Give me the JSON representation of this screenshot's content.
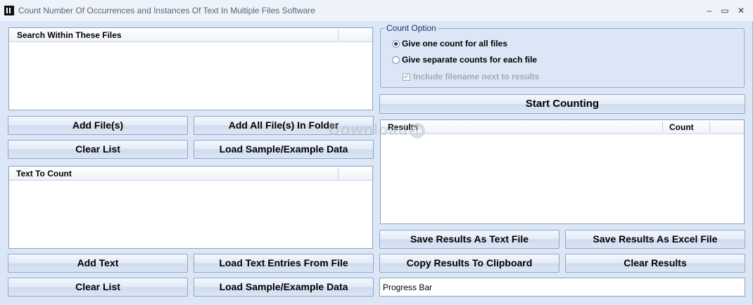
{
  "window": {
    "title": "Count Number Of Occurrences and Instances Of Text In Multiple Files Software",
    "minimize": "–",
    "maximize": "▭",
    "close": "✕"
  },
  "files_panel": {
    "header": "Search Within These Files",
    "add_files": "Add File(s)",
    "add_folder": "Add All File(s) In Folder",
    "clear_list": "Clear List",
    "load_sample": "Load Sample/Example Data"
  },
  "text_panel": {
    "header": "Text To Count",
    "add_text": "Add Text",
    "load_entries": "Load Text Entries From File",
    "clear_list": "Clear List",
    "load_sample": "Load Sample/Example Data"
  },
  "count_option": {
    "legend": "Count Option",
    "one_count": "Give one count for all files",
    "separate_counts": "Give separate counts for each file",
    "include_filename": "Include filename next to results",
    "selected": "one_count"
  },
  "start_counting": "Start Counting",
  "results": {
    "col_results": "Results",
    "col_count": "Count",
    "rows": []
  },
  "actions": {
    "save_text": "Save Results As Text File",
    "save_excel": "Save Results As Excel File",
    "copy_clipboard": "Copy Results To Clipboard",
    "clear_results": "Clear Results"
  },
  "progress_label": "Progress Bar",
  "watermark": {
    "text": "Download",
    "badge": "3k"
  }
}
